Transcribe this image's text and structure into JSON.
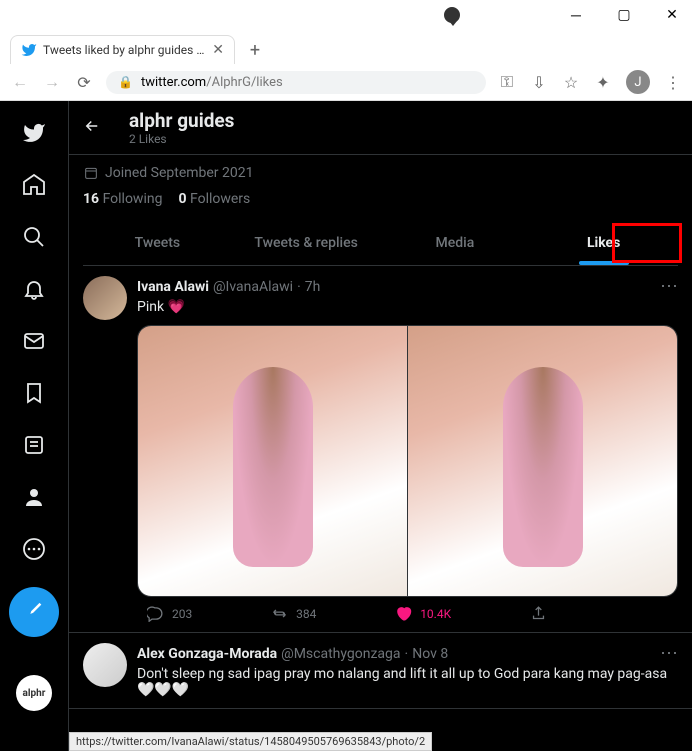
{
  "browser": {
    "tab_title": "Tweets liked by alphr guides (@A",
    "url_domain": "twitter.com",
    "url_path": "/AlphrG/likes",
    "profile_letter": "J"
  },
  "header": {
    "name": "alphr guides",
    "likes_count": "2 Likes"
  },
  "profile": {
    "joined": "Joined September 2021",
    "following_count": "16",
    "following_label": "Following",
    "followers_count": "0",
    "followers_label": "Followers"
  },
  "tabs": [
    "Tweets",
    "Tweets & replies",
    "Media",
    "Likes"
  ],
  "tweets": [
    {
      "display_name": "Ivana Alawi",
      "handle": "@IvanaAlawi",
      "time": "7h",
      "text": "Pink 💗",
      "replies": "203",
      "retweets": "384",
      "likes": "10.4K"
    },
    {
      "display_name": "Alex Gonzaga-Morada",
      "handle": "@Mscathygonzaga",
      "time": "Nov 8",
      "text": "Don't sleep ng sad ipag pray mo nalang and lift it all up to God para kang may pag-asa 🤍🤍🤍"
    }
  ],
  "status_url": "https://twitter.com/IvanaAlawi/status/1458049505769635843/photo/2",
  "alphr_label": "alphr"
}
